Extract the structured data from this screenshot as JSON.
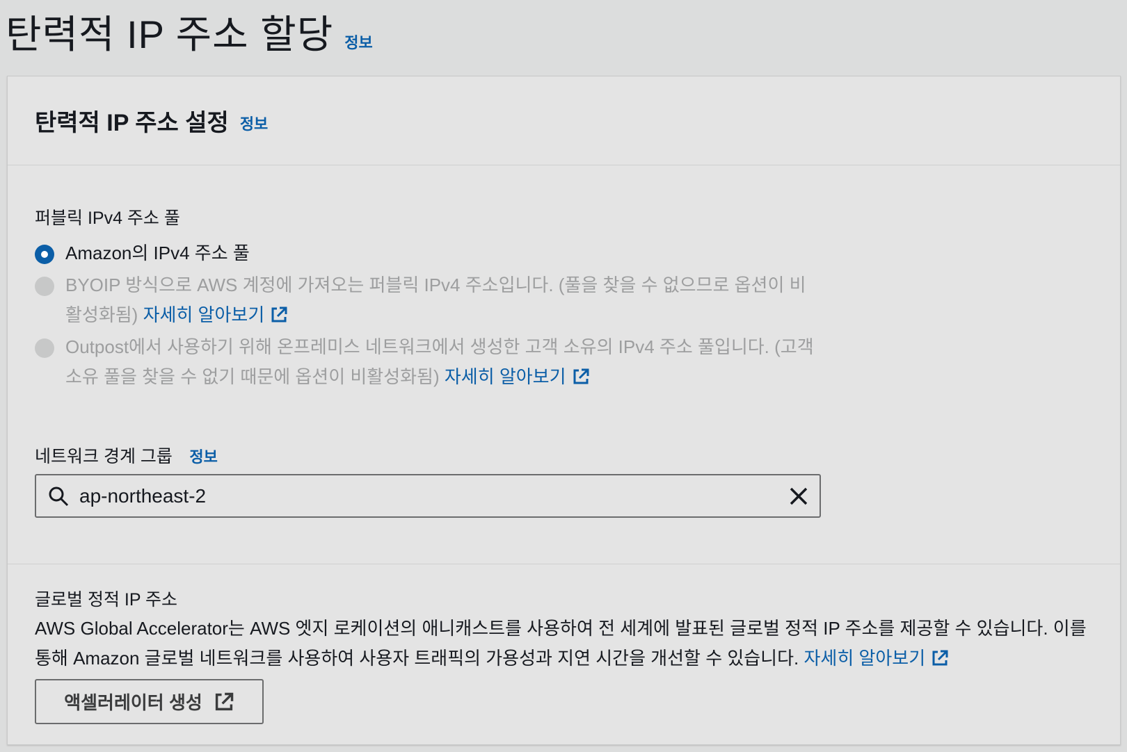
{
  "header": {
    "title": "탄력적 IP 주소 할당",
    "info": "정보"
  },
  "settings": {
    "title": "탄력적 IP 주소 설정",
    "info": "정보",
    "pool_label": "퍼블릭 IPv4 주소 풀",
    "options": [
      {
        "label": "Amazon의 IPv4 주소 풀",
        "selected": true,
        "disabled": false
      },
      {
        "label": "BYOIP 방식으로 AWS 계정에 가져오는 퍼블릭 IPv4 주소입니다. (풀을 찾을 수 없으므로 옵션이 비활성화됨)",
        "link": "자세히 알아보기",
        "selected": false,
        "disabled": true
      },
      {
        "label": "Outpost에서 사용하기 위해 온프레미스 네트워크에서 생성한 고객 소유의 IPv4 주소 풀입니다. (고객 소유 풀을 찾을 수 없기 때문에 옵션이 비활성화됨)",
        "link": "자세히 알아보기",
        "selected": false,
        "disabled": true
      }
    ],
    "nbg_label": "네트워크 경계 그룹",
    "nbg_info": "정보",
    "nbg_value": "ap-northeast-2"
  },
  "global": {
    "label": "글로벌 정적 IP 주소",
    "description": "AWS Global Accelerator는 AWS 엣지 로케이션의 애니캐스트를 사용하여 전 세계에 발표된 글로벌 정적 IP 주소를 제공할 수 있습니다. 이를 통해 Amazon 글로벌 네트워크를 사용하여 사용자 트래픽의 가용성과 지연 시간을 개선할 수 있습니다.",
    "link": "자세히 알아보기",
    "button": "액셀러레이터 생성"
  },
  "colors": {
    "link": "#0b5ea7",
    "radio_selected": "#0b5ea7",
    "disabled_text": "#9d9e9f",
    "background": "#dcdddd"
  },
  "icons": [
    "search-icon",
    "clear-icon",
    "external-link-icon"
  ]
}
